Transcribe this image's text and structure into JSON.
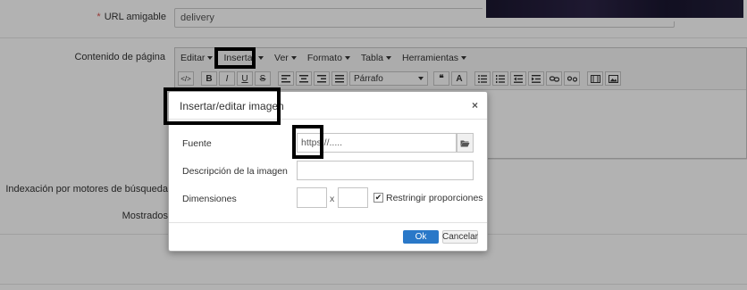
{
  "form": {
    "url_label": "URL amigable",
    "url_required_mark": "*",
    "url_value": "delivery",
    "content_label": "Contenido de página",
    "indexing_label": "Indexación por motores de búsqueda",
    "shown_label": "Mostrados"
  },
  "editor": {
    "menu": [
      {
        "label": "Editar"
      },
      {
        "label": "Insertar"
      },
      {
        "label": "Ver"
      },
      {
        "label": "Formato"
      },
      {
        "label": "Tabla"
      },
      {
        "label": "Herramientas"
      }
    ],
    "block_format": "Párrafo",
    "toolbar_glyphs": {
      "source": "</>",
      "bold": "B",
      "italic": "I",
      "underline": "U",
      "strike": "S",
      "quote": "❝",
      "clear": "A"
    }
  },
  "dialog": {
    "title": "Insertar/editar imagen",
    "close_glyph": "×",
    "source_label": "Fuente",
    "source_value": "https://.....",
    "description_label": "Descripción de la imagen",
    "description_value": "",
    "dimensions_label": "Dimensiones",
    "width_value": "",
    "height_value": "",
    "dim_separator": "x",
    "constrain_label": "Restringir proporciones",
    "constrain_checked": true,
    "ok_label": "Ok",
    "cancel_label": "Cancelar"
  },
  "colors": {
    "primary_button": "#2a78c8",
    "required": "#d9534f",
    "highlight_box": "#000000"
  }
}
